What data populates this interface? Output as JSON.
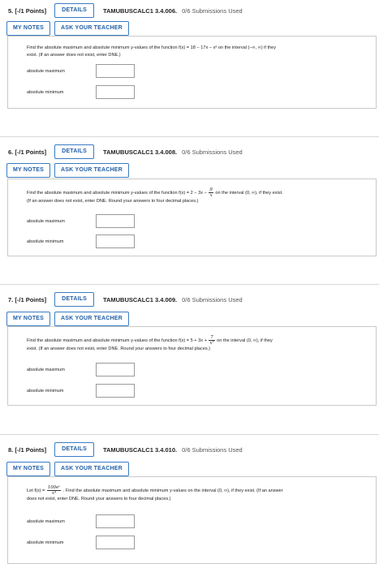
{
  "questions": [
    {
      "number": "5.",
      "points": "[-/1 Points]",
      "details": "DETAILS",
      "code": "TAMUBUSCALC1 3.4.006.",
      "submissions": "0/6 Submissions Used",
      "my_notes": "MY NOTES",
      "ask_teacher": "ASK YOUR TEACHER",
      "text_line1": "Find the absolute maximum and absolute minimum y-values of the function f(x) = 18 − 17x − x² on the interval (−∞, ∞) if they",
      "text_line2": "exist. (If an answer does not exist, enter DNE.)",
      "max_label": "absolute maximum",
      "min_label": "absolute minimum",
      "max_value": "",
      "min_value": ""
    },
    {
      "number": "6.",
      "points": "[-/1 Points]",
      "details": "DETAILS",
      "code": "TAMUBUSCALC1 3.4.008.",
      "submissions": "0/6 Submissions Used",
      "my_notes": "MY NOTES",
      "ask_teacher": "ASK YOUR TEACHER",
      "text_pre": "Find the absolute maximum and absolute minimum y-values of the function f(x) = 2 − 3x −",
      "frac_num": "9",
      "frac_den": "x",
      "text_post": "on the interval (0, ∞), if they exist.",
      "text_line2": "(If an answer does not exist, enter DNE. Round your answers to four decimal places.)",
      "max_label": "absolute maximum",
      "min_label": "absolute minimum",
      "max_value": "",
      "min_value": ""
    },
    {
      "number": "7.",
      "points": "[-/1 Points]",
      "details": "DETAILS",
      "code": "TAMUBUSCALC1 3.4.009.",
      "submissions": "0/6 Submissions Used",
      "my_notes": "MY NOTES",
      "ask_teacher": "ASK YOUR TEACHER",
      "text_pre": "Find the absolute maximum and absolute minimum y-values of the function f(x) = 5 + 3x +",
      "frac_num": "7",
      "frac_den": "x²",
      "text_post": "on the interval (0, ∞), if they",
      "text_line2": "exist. (If an answer does not exist, enter DNE. Round your answers to four decimal places.)",
      "max_label": "absolute maximum",
      "min_label": "absolute minimum",
      "max_value": "",
      "min_value": ""
    },
    {
      "number": "8.",
      "points": "[-/1 Points]",
      "details": "DETAILS",
      "code": "TAMUBUSCALC1 3.4.010.",
      "submissions": "0/6 Submissions Used",
      "my_notes": "MY NOTES",
      "ask_teacher": "ASK YOUR TEACHER",
      "text_pre": "Let f(x) =",
      "frac_num": "100eˣ",
      "frac_den": "x⁴",
      "text_post": ". Find the absolute maximum and absolute minimum y-values on the interval (0, ∞), if they exist. (If an answer",
      "text_line2": "does not exist, enter DNE. Round your answers to four decimal places.)",
      "max_label": "absolute maximum",
      "min_label": "absolute minimum",
      "max_value": "",
      "min_value": ""
    }
  ],
  "colors": {
    "button_border": "#3a7cc4",
    "button_text": "#1f5fa8",
    "box_border": "#c9c9c9"
  }
}
